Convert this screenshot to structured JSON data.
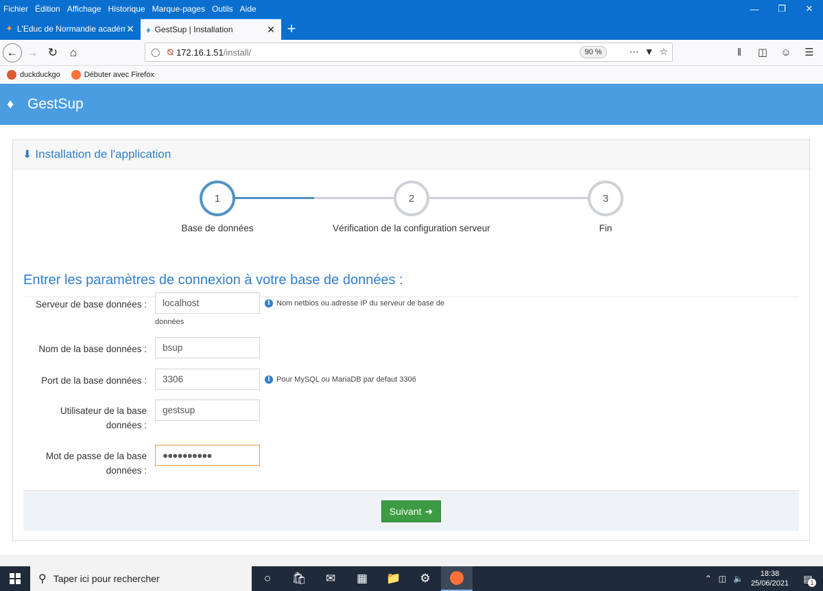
{
  "browser": {
    "menu": [
      {
        "label": "Fichier"
      },
      {
        "label": "Édition"
      },
      {
        "label": "Affichage"
      },
      {
        "label": "Historique"
      },
      {
        "label": "Marque-pages"
      },
      {
        "label": "Outils"
      },
      {
        "label": "Aide"
      }
    ],
    "tabs": [
      {
        "title": "L'Educ de Normandie académ",
        "active": false
      },
      {
        "title": "GestSup | Installation",
        "active": true
      }
    ],
    "url_host": "172.16.1.51",
    "url_path": "/install/",
    "zoom": "90 %",
    "bookmarks": [
      {
        "label": "duckduckgo"
      },
      {
        "label": "Débuter avec Firefox"
      }
    ]
  },
  "app": {
    "title": "GestSup"
  },
  "panel": {
    "title": "Installation de l'application"
  },
  "steps": [
    {
      "number": "1",
      "label": "Base de données",
      "active": true
    },
    {
      "number": "2",
      "label": "Vérification de la configuration serveur",
      "active": false
    },
    {
      "number": "3",
      "label": "Fin",
      "active": false
    }
  ],
  "form": {
    "title": "Entrer les paramètres de connexion à votre base de données :",
    "server": {
      "label": "Serveur de base données :",
      "value": "localhost",
      "help": "Nom netbios ou adresse IP du serveur de base de",
      "help_cont": "données"
    },
    "dbname": {
      "label": "Nom de la base données :",
      "value": "bsup"
    },
    "port": {
      "label": "Port de la base données :",
      "value": "3306",
      "help": "Pour MySQL ou MariaDB par defaut 3306"
    },
    "user": {
      "label_1": "Utilisateur de la base",
      "label_2": "données :",
      "value": "gestsup"
    },
    "password": {
      "label_1": "Mot de passe de la base",
      "label_2": "données :",
      "value": "●●●●●●●●●●"
    },
    "next_label": "Suivant"
  },
  "taskbar": {
    "search_placeholder": "Taper ici pour rechercher",
    "time": "18:38",
    "date": "25/06/2021",
    "notif_count": "1"
  },
  "colors": {
    "browser_blue": "#0a6fce",
    "header_blue": "#4a9de0",
    "accent": "#307ecc",
    "success": "#3c9b43"
  }
}
